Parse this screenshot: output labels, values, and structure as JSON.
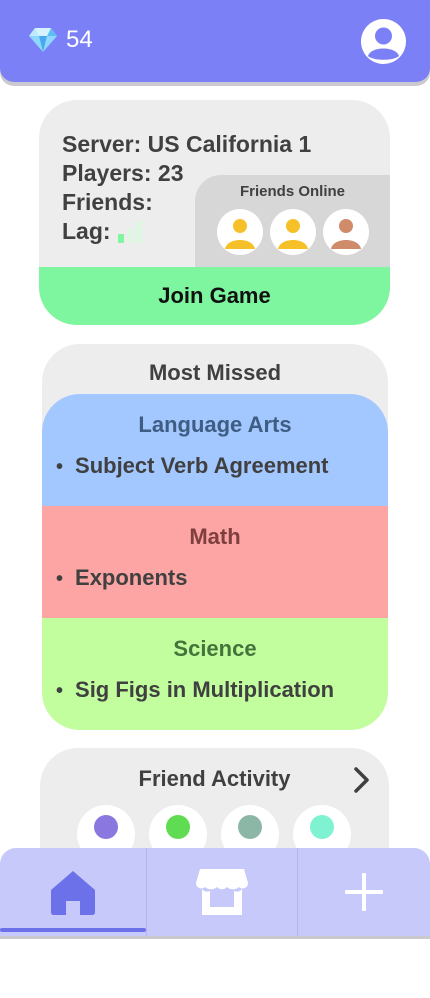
{
  "header": {
    "gem_count": "54",
    "gem_icon": "diamond-icon",
    "profile_icon": "user-icon",
    "bar_color": "#7b80f6"
  },
  "server": {
    "server_line": "Server: US California 1",
    "players_line": "Players: 23",
    "friends_line": "Friends:",
    "lag_label": "Lag:",
    "lag_level": "1 of 3 bars",
    "friends_online_title": "Friends Online",
    "friends_online_avatars": [
      "#f5c028",
      "#f5c028",
      "#cf8b6a"
    ],
    "join_label": "Join Game",
    "join_color": "#7ef59f"
  },
  "most_missed": {
    "title": "Most Missed",
    "subjects": [
      {
        "name": "Language Arts",
        "item": "Subject Verb Agreement",
        "bg": "#a3c8ff",
        "title_color": "#3f5d83"
      },
      {
        "name": "Math",
        "item": "Exponents",
        "bg": "#fca5a4",
        "title_color": "#7e3f3e"
      },
      {
        "name": "Science",
        "item": "Sig Figs in Multiplication",
        "bg": "#c2fd9e",
        "title_color": "#43743b"
      }
    ]
  },
  "friend_activity": {
    "title": "Friend Activity",
    "avatars": [
      "#8a78e0",
      "#5fdc52",
      "#8cb7a6",
      "#7ff2d2"
    ],
    "more_icon": "chevron-right-icon"
  },
  "nav": {
    "items": [
      {
        "icon": "home-icon",
        "active": true
      },
      {
        "icon": "store-icon",
        "active": false
      },
      {
        "icon": "plus-icon",
        "active": false
      }
    ],
    "bar_color": "#c8c9fb",
    "active_color": "#6c71ea"
  }
}
